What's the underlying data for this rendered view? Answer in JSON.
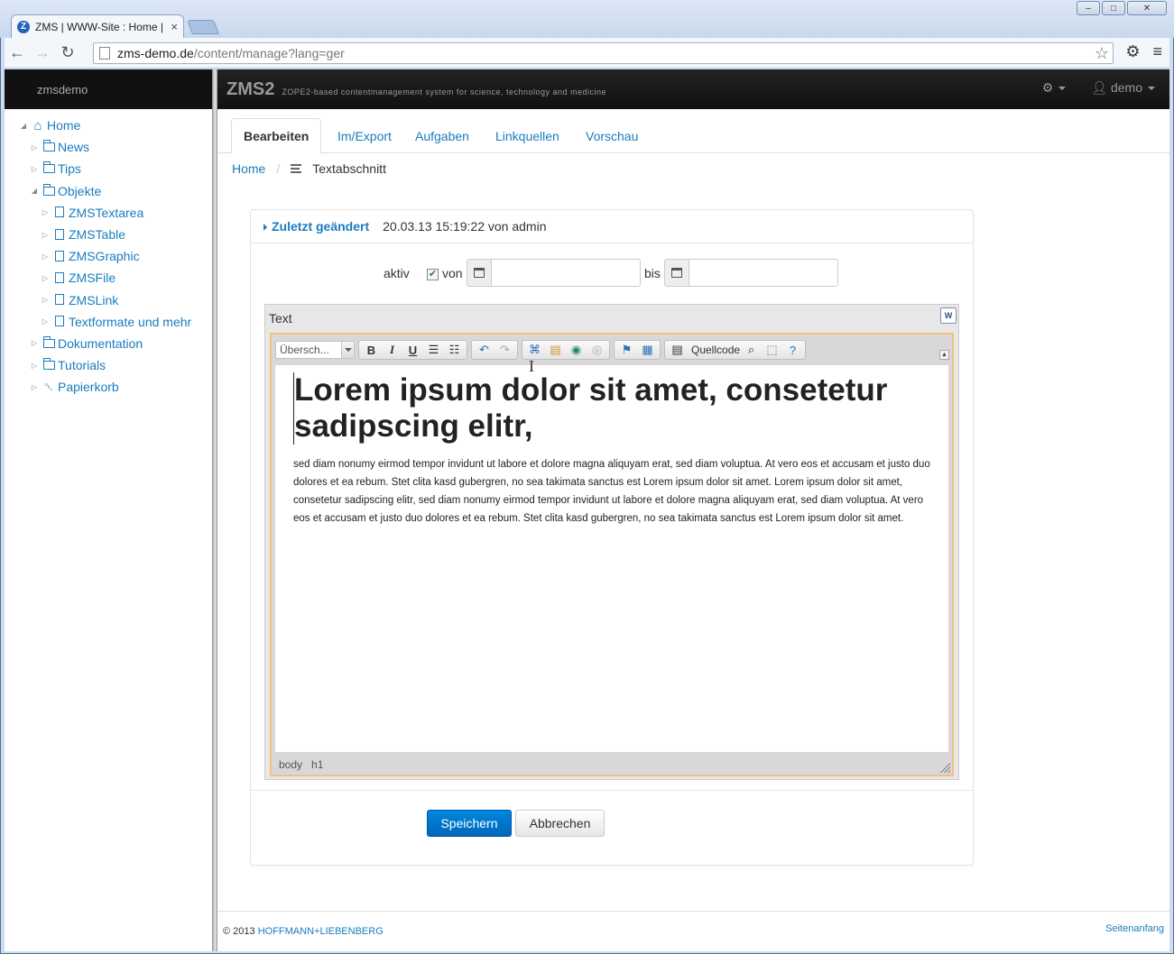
{
  "browser": {
    "tab_title": "ZMS | WWW-Site : Home | gé",
    "tab_close": "×",
    "url_host": "zms-demo.de",
    "url_path": "/content/manage?lang=ger",
    "win_minimize": "–",
    "win_maximize": "□",
    "win_close": "✕"
  },
  "sidebar": {
    "header": "zmsdemo",
    "items": [
      {
        "label": "Home",
        "level": 0,
        "expanded": true,
        "icon": "home-icon"
      },
      {
        "label": "News",
        "level": 1,
        "expanded": false,
        "icon": "folder-icon"
      },
      {
        "label": "Tips",
        "level": 1,
        "expanded": false,
        "icon": "folder-icon"
      },
      {
        "label": "Objekte",
        "level": 1,
        "expanded": true,
        "icon": "folder-icon"
      },
      {
        "label": "ZMSTextarea",
        "level": 2,
        "expanded": false,
        "icon": "document-icon"
      },
      {
        "label": "ZMSTable",
        "level": 2,
        "expanded": false,
        "icon": "document-icon"
      },
      {
        "label": "ZMSGraphic",
        "level": 2,
        "expanded": false,
        "icon": "document-icon"
      },
      {
        "label": "ZMSFile",
        "level": 2,
        "expanded": false,
        "icon": "document-icon"
      },
      {
        "label": "ZMSLink",
        "level": 2,
        "expanded": false,
        "icon": "document-icon"
      },
      {
        "label": "Textformate und mehr",
        "level": 2,
        "expanded": false,
        "icon": "document-icon"
      },
      {
        "label": "Dokumentation",
        "level": 1,
        "expanded": false,
        "icon": "folder-icon"
      },
      {
        "label": "Tutorials",
        "level": 1,
        "expanded": false,
        "icon": "folder-icon"
      },
      {
        "label": "Papierkorb",
        "level": 1,
        "expanded": false,
        "icon": "trash-icon"
      }
    ]
  },
  "navbar": {
    "brand": "ZMS2",
    "subtitle": "ZOPE2-based contentmanagement system for science, technology and medicine",
    "user": "demo"
  },
  "tabs": [
    {
      "label": "Bearbeiten",
      "active": true
    },
    {
      "label": "Im/Export",
      "active": false
    },
    {
      "label": "Aufgaben",
      "active": false
    },
    {
      "label": "Linkquellen",
      "active": false
    },
    {
      "label": "Vorschau",
      "active": false
    }
  ],
  "breadcrumb": {
    "home": "Home",
    "separator": "/",
    "current": "Textabschnitt"
  },
  "form": {
    "changed_label": "Zuletzt geändert",
    "changed_info": "20.03.13 15:19:22 von admin",
    "aktiv_label": "aktiv",
    "aktiv_checked": true,
    "von_label": "von",
    "bis_label": "bis",
    "von_value": "",
    "bis_value": "",
    "text_label": "Text"
  },
  "editor": {
    "format_combo": "Übersch...",
    "source_label": "Quellcode",
    "heading": "Lorem ipsum dolor sit amet, consetetur sadipscing elitr,",
    "paragraph": "sed diam nonumy eirmod tempor invidunt ut labore et dolore magna aliquyam erat, sed diam voluptua. At vero eos et accusam et justo duo dolores et ea rebum. Stet clita kasd gubergren, no sea takimata sanctus est Lorem ipsum dolor sit amet. Lorem ipsum dolor sit amet, consetetur sadipscing elitr, sed diam nonumy eirmod tempor invidunt ut labore et dolore magna aliquyam erat, sed diam voluptua. At vero eos et accusam et justo duo dolores et ea rebum. Stet clita kasd gubergren, no sea takimata sanctus est Lorem ipsum dolor sit amet.",
    "path_body": "body",
    "path_h1": "h1"
  },
  "buttons": {
    "save": "Speichern",
    "cancel": "Abbrechen"
  },
  "footer": {
    "copyright": "© 2013",
    "company": "HOFFMANN+LIEBENBERG",
    "top_link": "Seitenanfang"
  },
  "colors": {
    "link": "#1a7cbf",
    "primary_button": "#0074cc",
    "navbar": "#1b1b1b",
    "editor_focus_border": "#f0c27a"
  }
}
